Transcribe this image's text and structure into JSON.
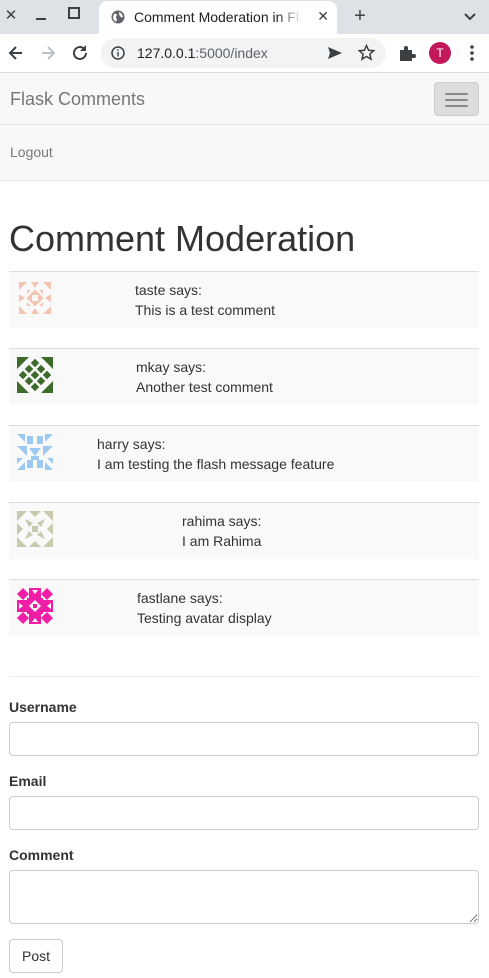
{
  "browser": {
    "tab_title": "Comment Moderation in Flask",
    "url_host": "127.0.0.1",
    "url_rest": ":5000/index",
    "profile_initial": "T",
    "new_tab_symbol": "+"
  },
  "navbar": {
    "brand": "Flask Comments",
    "logout": "Logout"
  },
  "page": {
    "heading": "Comment Moderation"
  },
  "comments": [
    {
      "user": "taste says:",
      "text": "This is a test comment",
      "avatar_color": "#f2c4b4"
    },
    {
      "user": "mkay says:",
      "text": "Another test comment",
      "avatar_color": "#3f6b2a"
    },
    {
      "user": "harry says:",
      "text": "I am testing the flash message feature",
      "avatar_color": "#9ec9f2"
    },
    {
      "user": "rahima says:",
      "text": "I am Rahima",
      "avatar_color": "#c8c9ad"
    },
    {
      "user": "fastlane says:",
      "text": "Testing avatar display",
      "avatar_color": "#ee1ea7"
    }
  ],
  "form": {
    "username_label": "Username",
    "email_label": "Email",
    "comment_label": "Comment",
    "post_label": "Post"
  }
}
